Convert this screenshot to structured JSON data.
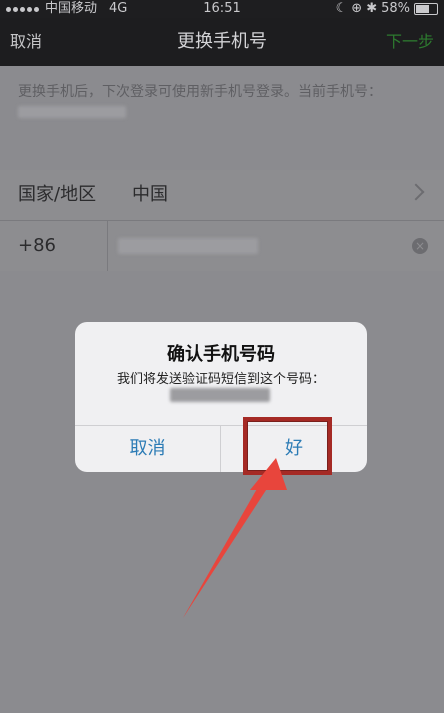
{
  "status_bar": {
    "carrier": "中国移动",
    "network": "4G",
    "time": "16:51",
    "battery": "58%",
    "battery_level": 0.58
  },
  "nav": {
    "cancel": "取消",
    "title": "更换手机号",
    "next": "下一步"
  },
  "description": {
    "text": "更换手机后，下次登录可使用新手机号登录。当前手机号："
  },
  "form": {
    "region_label": "国家/地区",
    "region_value": "中国",
    "country_code": "+86"
  },
  "dialog": {
    "title": "确认手机号码",
    "message": "我们将发送验证码短信到这个号码：",
    "cancel": "取消",
    "ok": "好"
  },
  "colors": {
    "next_button": "#2d7a2f",
    "dialog_button": "#2b7bb5",
    "highlight": "#a52a25",
    "arrow": "#e8453c"
  }
}
